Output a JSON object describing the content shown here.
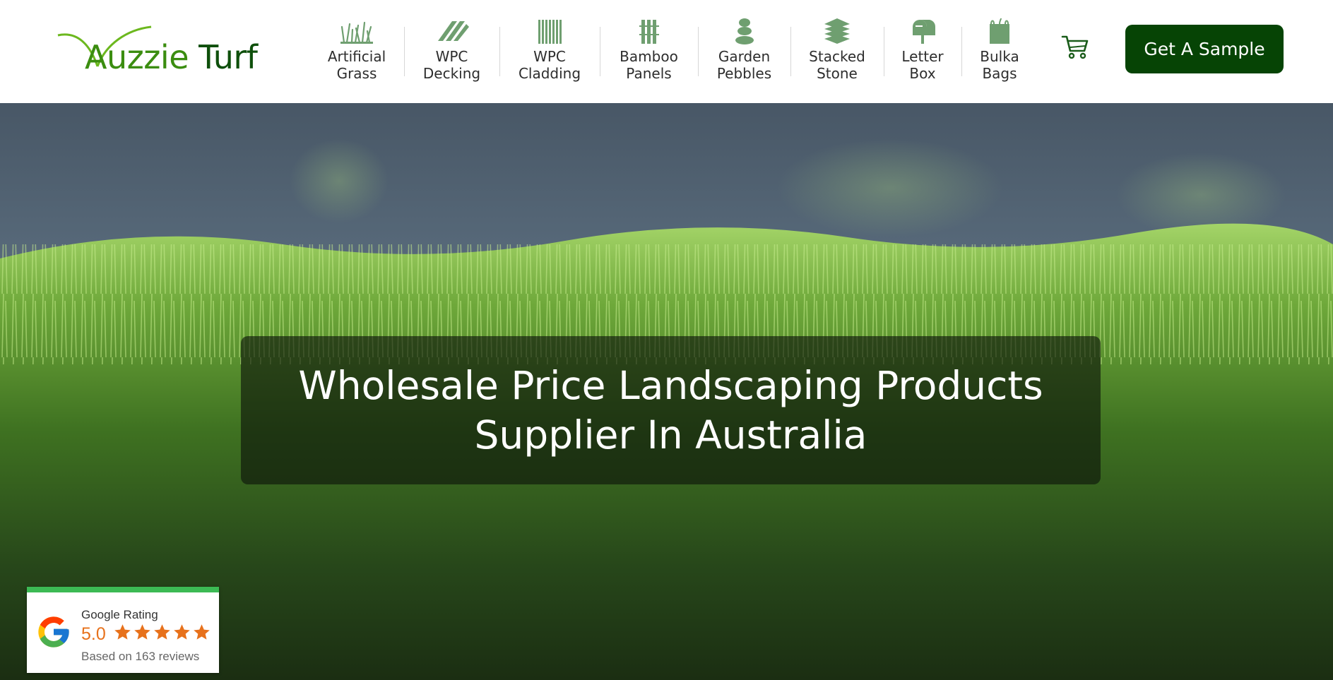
{
  "brand": {
    "logo_first": "A",
    "logo_rest": "uzzie",
    "logo_second": "Turf",
    "colors": {
      "green_light": "#3b8d10",
      "green_dark": "#0e4f0b"
    }
  },
  "nav": {
    "items": [
      {
        "label": "Artificial\nGrass",
        "icon": "grass-icon"
      },
      {
        "label": "WPC\nDecking",
        "icon": "decking-boards-icon"
      },
      {
        "label": "WPC\nCladding",
        "icon": "cladding-panel-icon"
      },
      {
        "label": "Bamboo\nPanels",
        "icon": "bamboo-panel-icon"
      },
      {
        "label": "Garden\nPebbles",
        "icon": "pebbles-icon"
      },
      {
        "label": "Stacked\nStone",
        "icon": "stacked-stone-icon"
      },
      {
        "label": "Letter\nBox",
        "icon": "mailbox-icon"
      },
      {
        "label": "Bulka\nBags",
        "icon": "bulk-bag-icon"
      }
    ]
  },
  "header": {
    "cart_icon": "shopping-cart-icon",
    "cta_label": "Get A Sample",
    "cta_color": "#064405"
  },
  "hero": {
    "headline_line1": "Wholesale Price Landscaping Products",
    "headline_line2": "Supplier In Australia"
  },
  "rating_widget": {
    "title": "Google Rating",
    "score": "5.0",
    "stars": 5,
    "reviews_text": "Based on 163 reviews",
    "icon": "google-g-icon",
    "star_color": "#e7711b",
    "accent_color": "#3cba54"
  }
}
